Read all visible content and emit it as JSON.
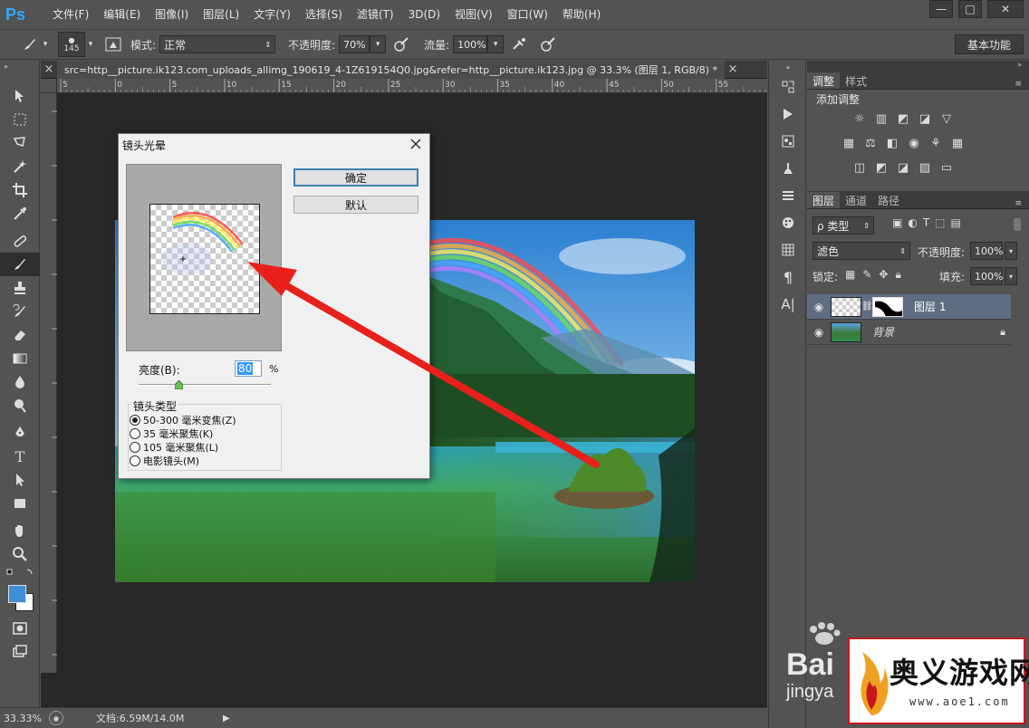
{
  "app": {
    "logo": "Ps"
  },
  "menu": [
    "文件(F)",
    "编辑(E)",
    "图像(I)",
    "图层(L)",
    "文字(Y)",
    "选择(S)",
    "滤镜(T)",
    "3D(D)",
    "视图(V)",
    "窗口(W)",
    "帮助(H)"
  ],
  "window_controls": {
    "minimize": "—",
    "maximize": "□",
    "close": "✕"
  },
  "options": {
    "brush_size": "145",
    "mode_label": "模式:",
    "mode_value": "正常",
    "opacity_label": "不透明度:",
    "opacity_value": "70%",
    "flow_label": "流量:",
    "flow_value": "100%",
    "workspace": "基本功能"
  },
  "document": {
    "tab_title": "src=http__picture.ik123.com_uploads_allimg_190619_4-1Z619154Q0.jpg&refer=http__picture.ik123.jpg @ 33.3% (图层 1, RGB/8) *",
    "close": "×",
    "ruler_ticks": [
      "5",
      "0",
      "5",
      "10",
      "15",
      "20",
      "25",
      "30",
      "35",
      "40",
      "45",
      "50",
      "55"
    ]
  },
  "status": {
    "zoom": "33.33%",
    "doc_info": "文档:6.59M/14.0M"
  },
  "dialog": {
    "title": "镜头光晕",
    "ok": "确定",
    "default": "默认",
    "brightness_label": "亮度(B):",
    "brightness_value": "80",
    "brightness_unit": "%",
    "brightness_level": 0.3,
    "lens_group_label": "镜头类型",
    "lens_options": [
      {
        "label": "50-300 毫米变焦(Z)",
        "checked": true
      },
      {
        "label": "35 毫米聚焦(K)",
        "checked": false
      },
      {
        "label": "105 毫米聚焦(L)",
        "checked": false
      },
      {
        "label": "电影镜头(M)",
        "checked": false
      }
    ]
  },
  "panels": {
    "adjust_tabs": [
      "调整",
      "样式"
    ],
    "adjust_title": "添加调整",
    "layers_tabs": [
      "图层",
      "通道",
      "路径"
    ],
    "kind_label": "ρ 类型",
    "blend_mode": "滤色",
    "opacity_label": "不透明度:",
    "opacity_value": "100%",
    "lock_label": "锁定:",
    "fill_label": "填充:",
    "fill_value": "100%",
    "layers": [
      {
        "name": "图层 1",
        "selected": true
      },
      {
        "name": "背景",
        "selected": false
      }
    ]
  },
  "watermarks": {
    "baidu_brand": "Bai",
    "baidu_sub": "jingya",
    "aoyi_name": "奥义游戏网",
    "aoyi_url": "www.aoe1.com"
  },
  "colors": {
    "ps_blue": "#31a8ff",
    "arrow_red": "#e8201c",
    "foreground": "#3e8fd6",
    "background": "#ffffff"
  }
}
